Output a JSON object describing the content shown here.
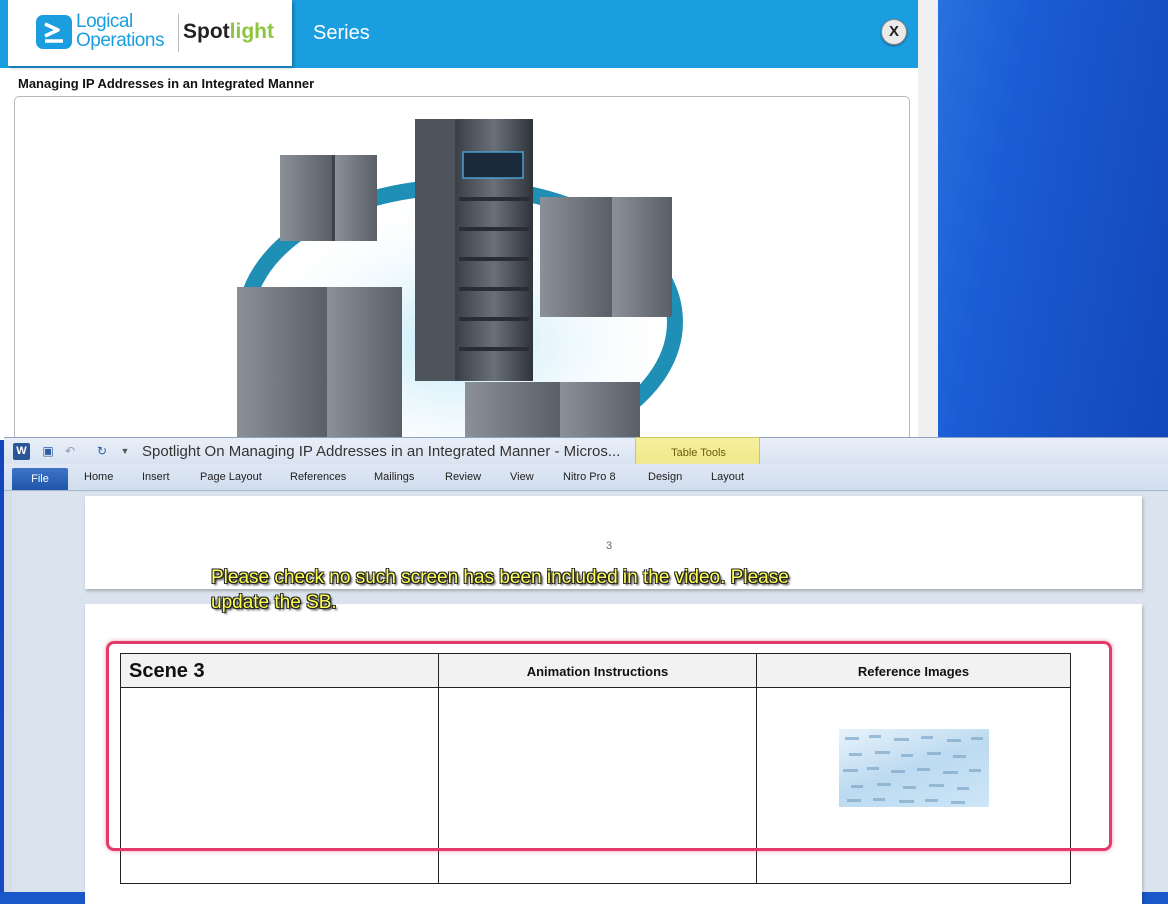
{
  "player": {
    "logo_line1": "Logical",
    "logo_line2": "Operations",
    "brand_spot": "Spot",
    "brand_light": "light",
    "series_label": "Series",
    "close_label": "X",
    "lesson_title": "Managing IP Addresses in an Integrated Manner",
    "accent_color": "#1a9ee0"
  },
  "word": {
    "app_icon": "W",
    "window_title": "Spotlight On Managing IP Addresses in an Integrated Manner  -  Micros...",
    "contextual_group": "Table Tools",
    "file_tab": "File",
    "tabs": [
      "Home",
      "Insert",
      "Page Layout",
      "References",
      "Mailings",
      "Review",
      "View",
      "Nitro Pro 8",
      "Design",
      "Layout"
    ],
    "page_number": "3"
  },
  "annotation": {
    "text_line1": "Please check no such screen has been included in the video. Please",
    "text_line2": "update the SB.",
    "color": "#ffff55"
  },
  "table": {
    "scene_title": "Scene 3",
    "col2_header": "Animation Instructions",
    "col3_header": "Reference Images"
  },
  "highlight_color": "#e23b6a"
}
